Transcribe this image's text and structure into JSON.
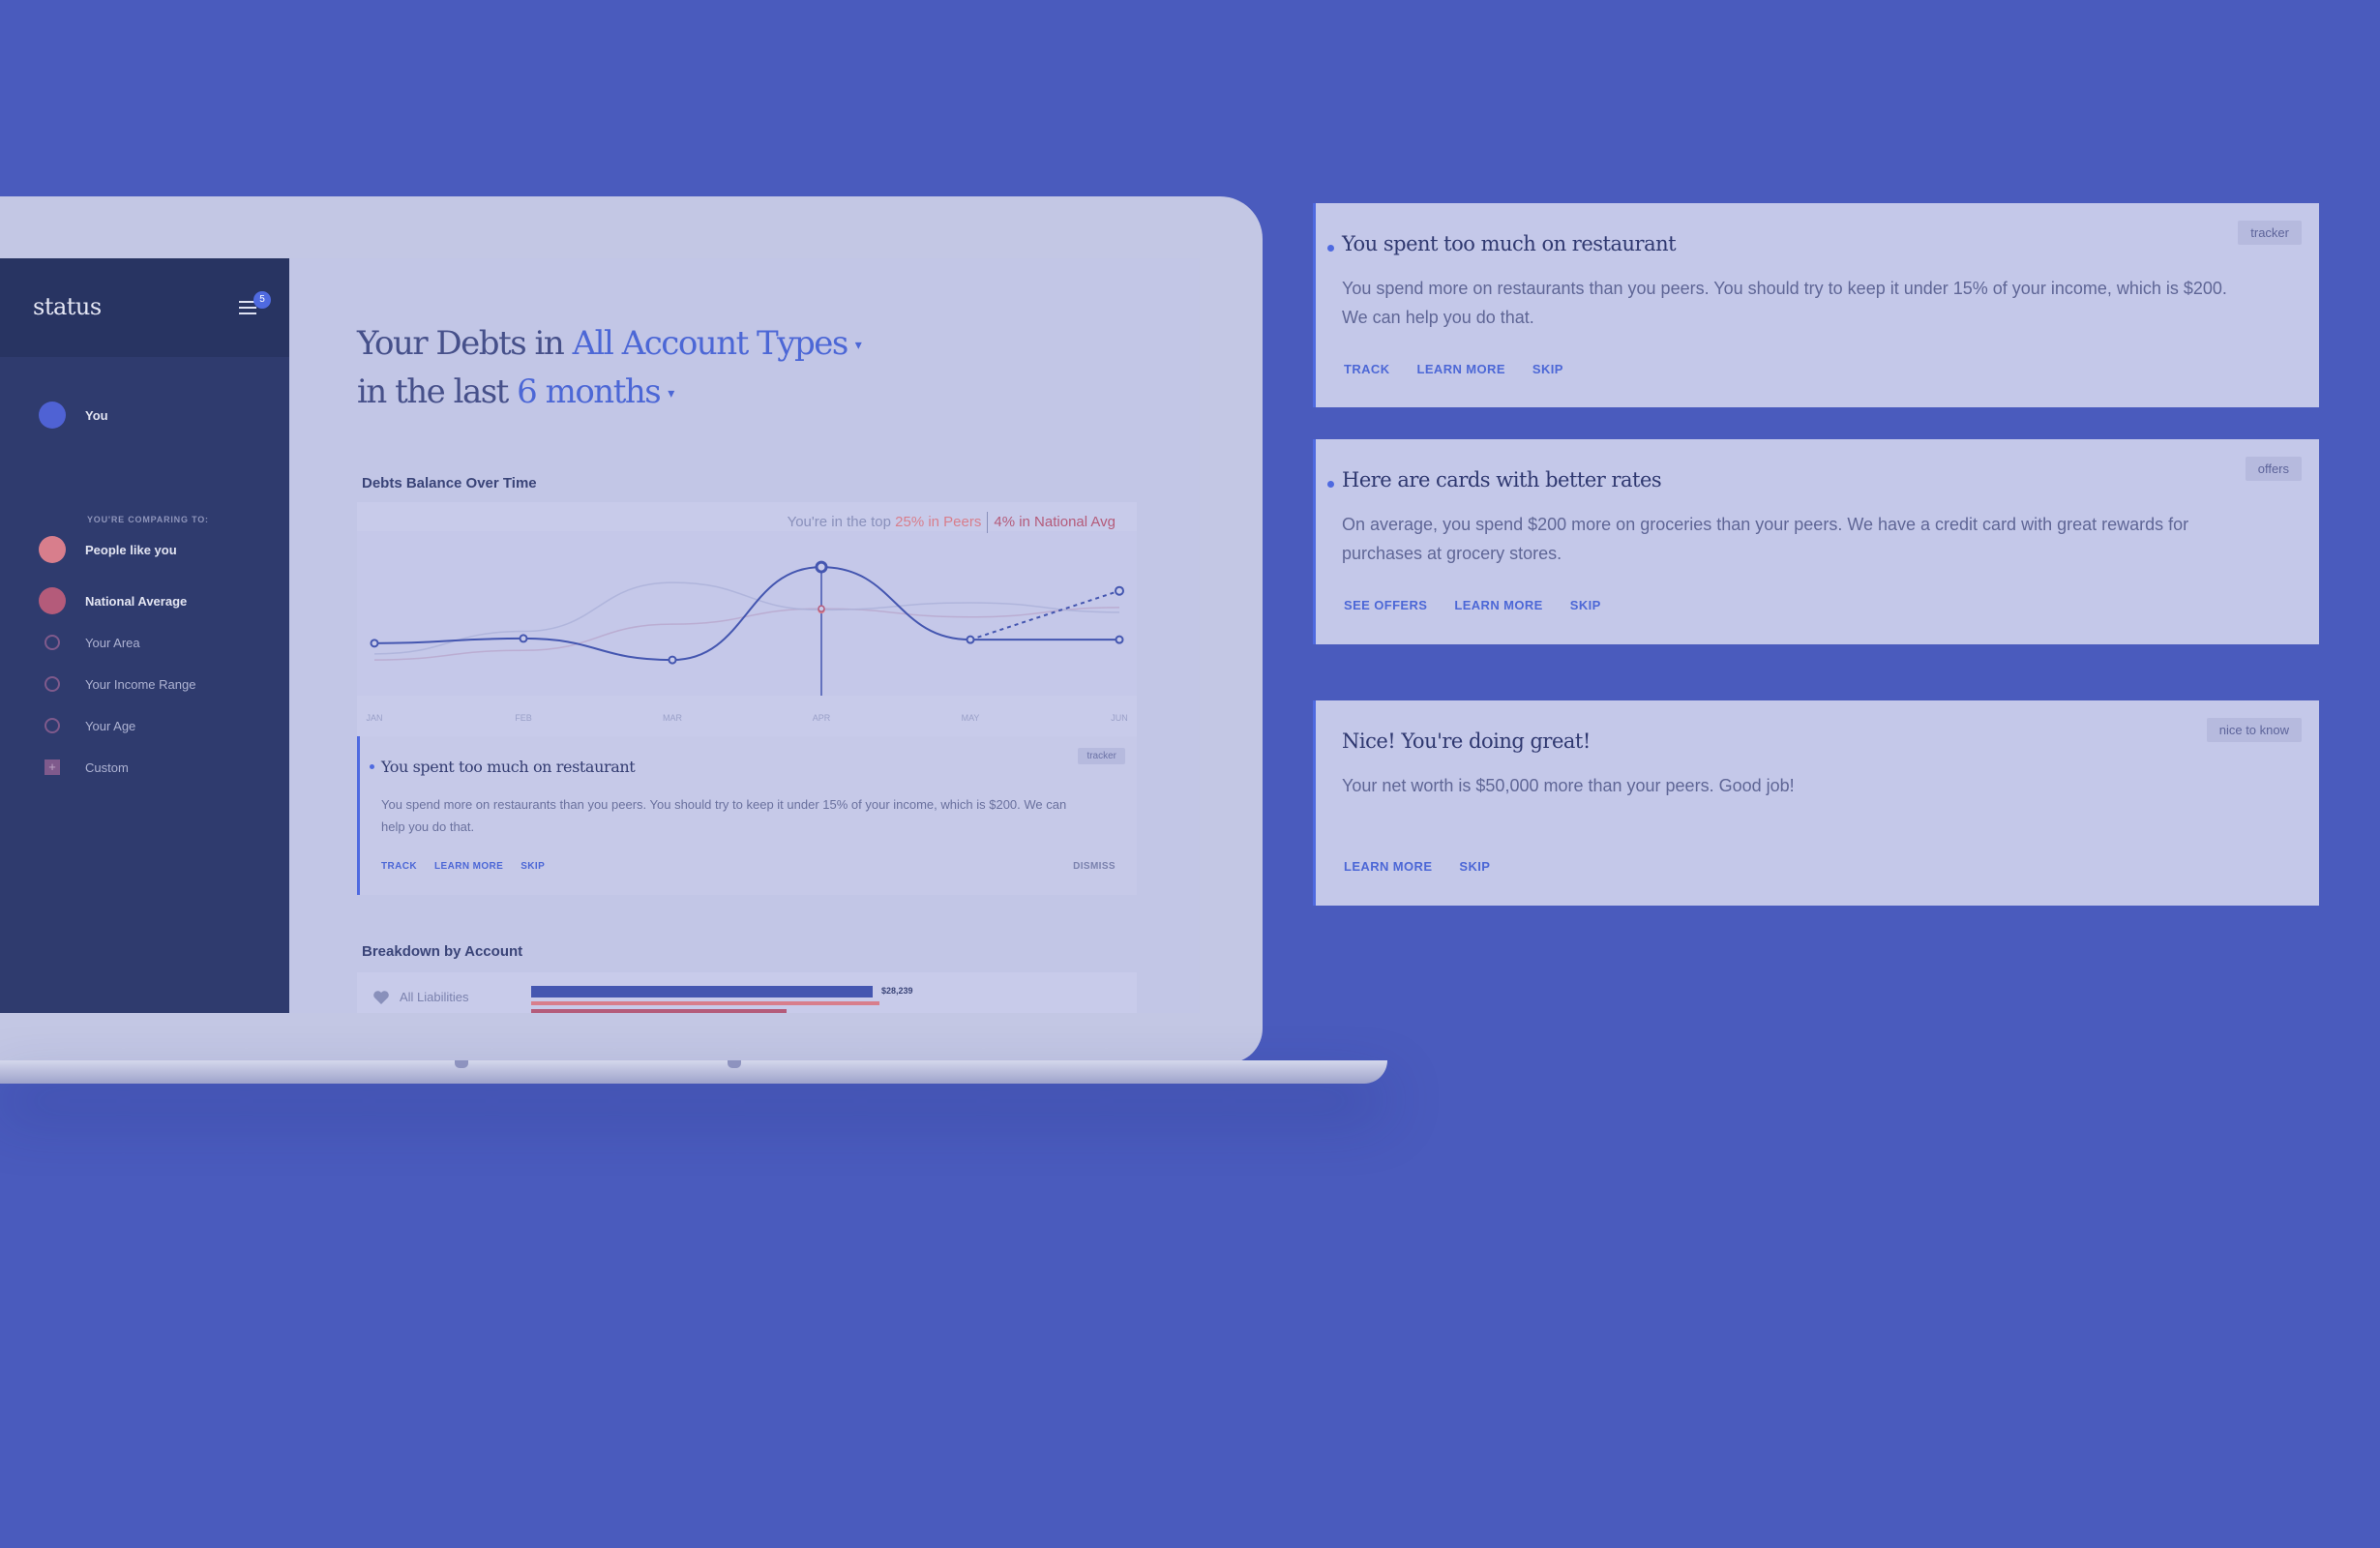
{
  "sidebar": {
    "logo": "status",
    "notification_count": "5",
    "you_label": "You",
    "comparing_caption": "YOU'RE COMPARING TO:",
    "items": [
      {
        "label": "People like you",
        "color": "#d87e8c"
      },
      {
        "label": "National Average",
        "color": "#b45b7a"
      },
      {
        "label": "Your Area"
      },
      {
        "label": "Your Income Range"
      },
      {
        "label": "Your Age"
      },
      {
        "label": "Custom"
      }
    ]
  },
  "headline": {
    "line1_prefix": "Your Debts in",
    "account_type": "All Account Types",
    "line2_prefix": "in the last",
    "period": "6 months"
  },
  "chart_section": {
    "title": "Debts Balance Over Time",
    "stat_prefix": "You're in the top",
    "stat_peers": "25% in Peers",
    "stat_national": "4%  in National Avg"
  },
  "chart_data": {
    "type": "line",
    "categories": [
      "JAN",
      "FEB",
      "MAR",
      "APR",
      "MAY",
      "JUN"
    ],
    "series": [
      {
        "values": [
          44,
          48,
          30,
          108,
          47,
          47
        ],
        "color": "#4456b0"
      },
      {
        "values": [
          35,
          54,
          95,
          72,
          78,
          70
        ],
        "color": "#aab0d8"
      },
      {
        "values": [
          30,
          38,
          60,
          73,
          66,
          74
        ],
        "color": "#b8a6cc"
      }
    ],
    "projection": {
      "from_index": 4,
      "to_value": 88
    },
    "highlight_index": 3,
    "ylim": [
      0,
      130
    ],
    "grid": false
  },
  "insight": {
    "tag": "tracker",
    "title": "You spent too much on restaurant",
    "body": "You spend more on restaurants than you peers. You should try to keep it under 15% of your income, which is $200. We can help you do that.",
    "actions": [
      "TRACK",
      "LEARN MORE",
      "SKIP"
    ],
    "dismiss": "DISMISS"
  },
  "breakdown": {
    "title": "Breakdown by Account",
    "row_label": "All Liabilities",
    "row_value": "$28,239"
  },
  "cards": [
    {
      "tag": "tracker",
      "title": "You spent too much on restaurant",
      "body": "You spend more on restaurants than you peers. You should try to keep it under 15% of your income, which is $200. We can help you do that.",
      "actions": [
        "TRACK",
        "LEARN MORE",
        "SKIP"
      ]
    },
    {
      "tag": "offers",
      "title": "Here are cards with better rates",
      "body": "On average, you spend $200 more on groceries than your peers. We have a credit card with great rewards for purchases at grocery stores.",
      "actions": [
        "SEE OFFERS",
        "LEARN MORE",
        "SKIP"
      ]
    },
    {
      "tag": "nice to know",
      "title": "Nice! You're doing great!",
      "body": "Your net worth is $50,000 more than your peers. Good job!",
      "actions": [
        "LEARN MORE",
        "SKIP"
      ]
    }
  ]
}
